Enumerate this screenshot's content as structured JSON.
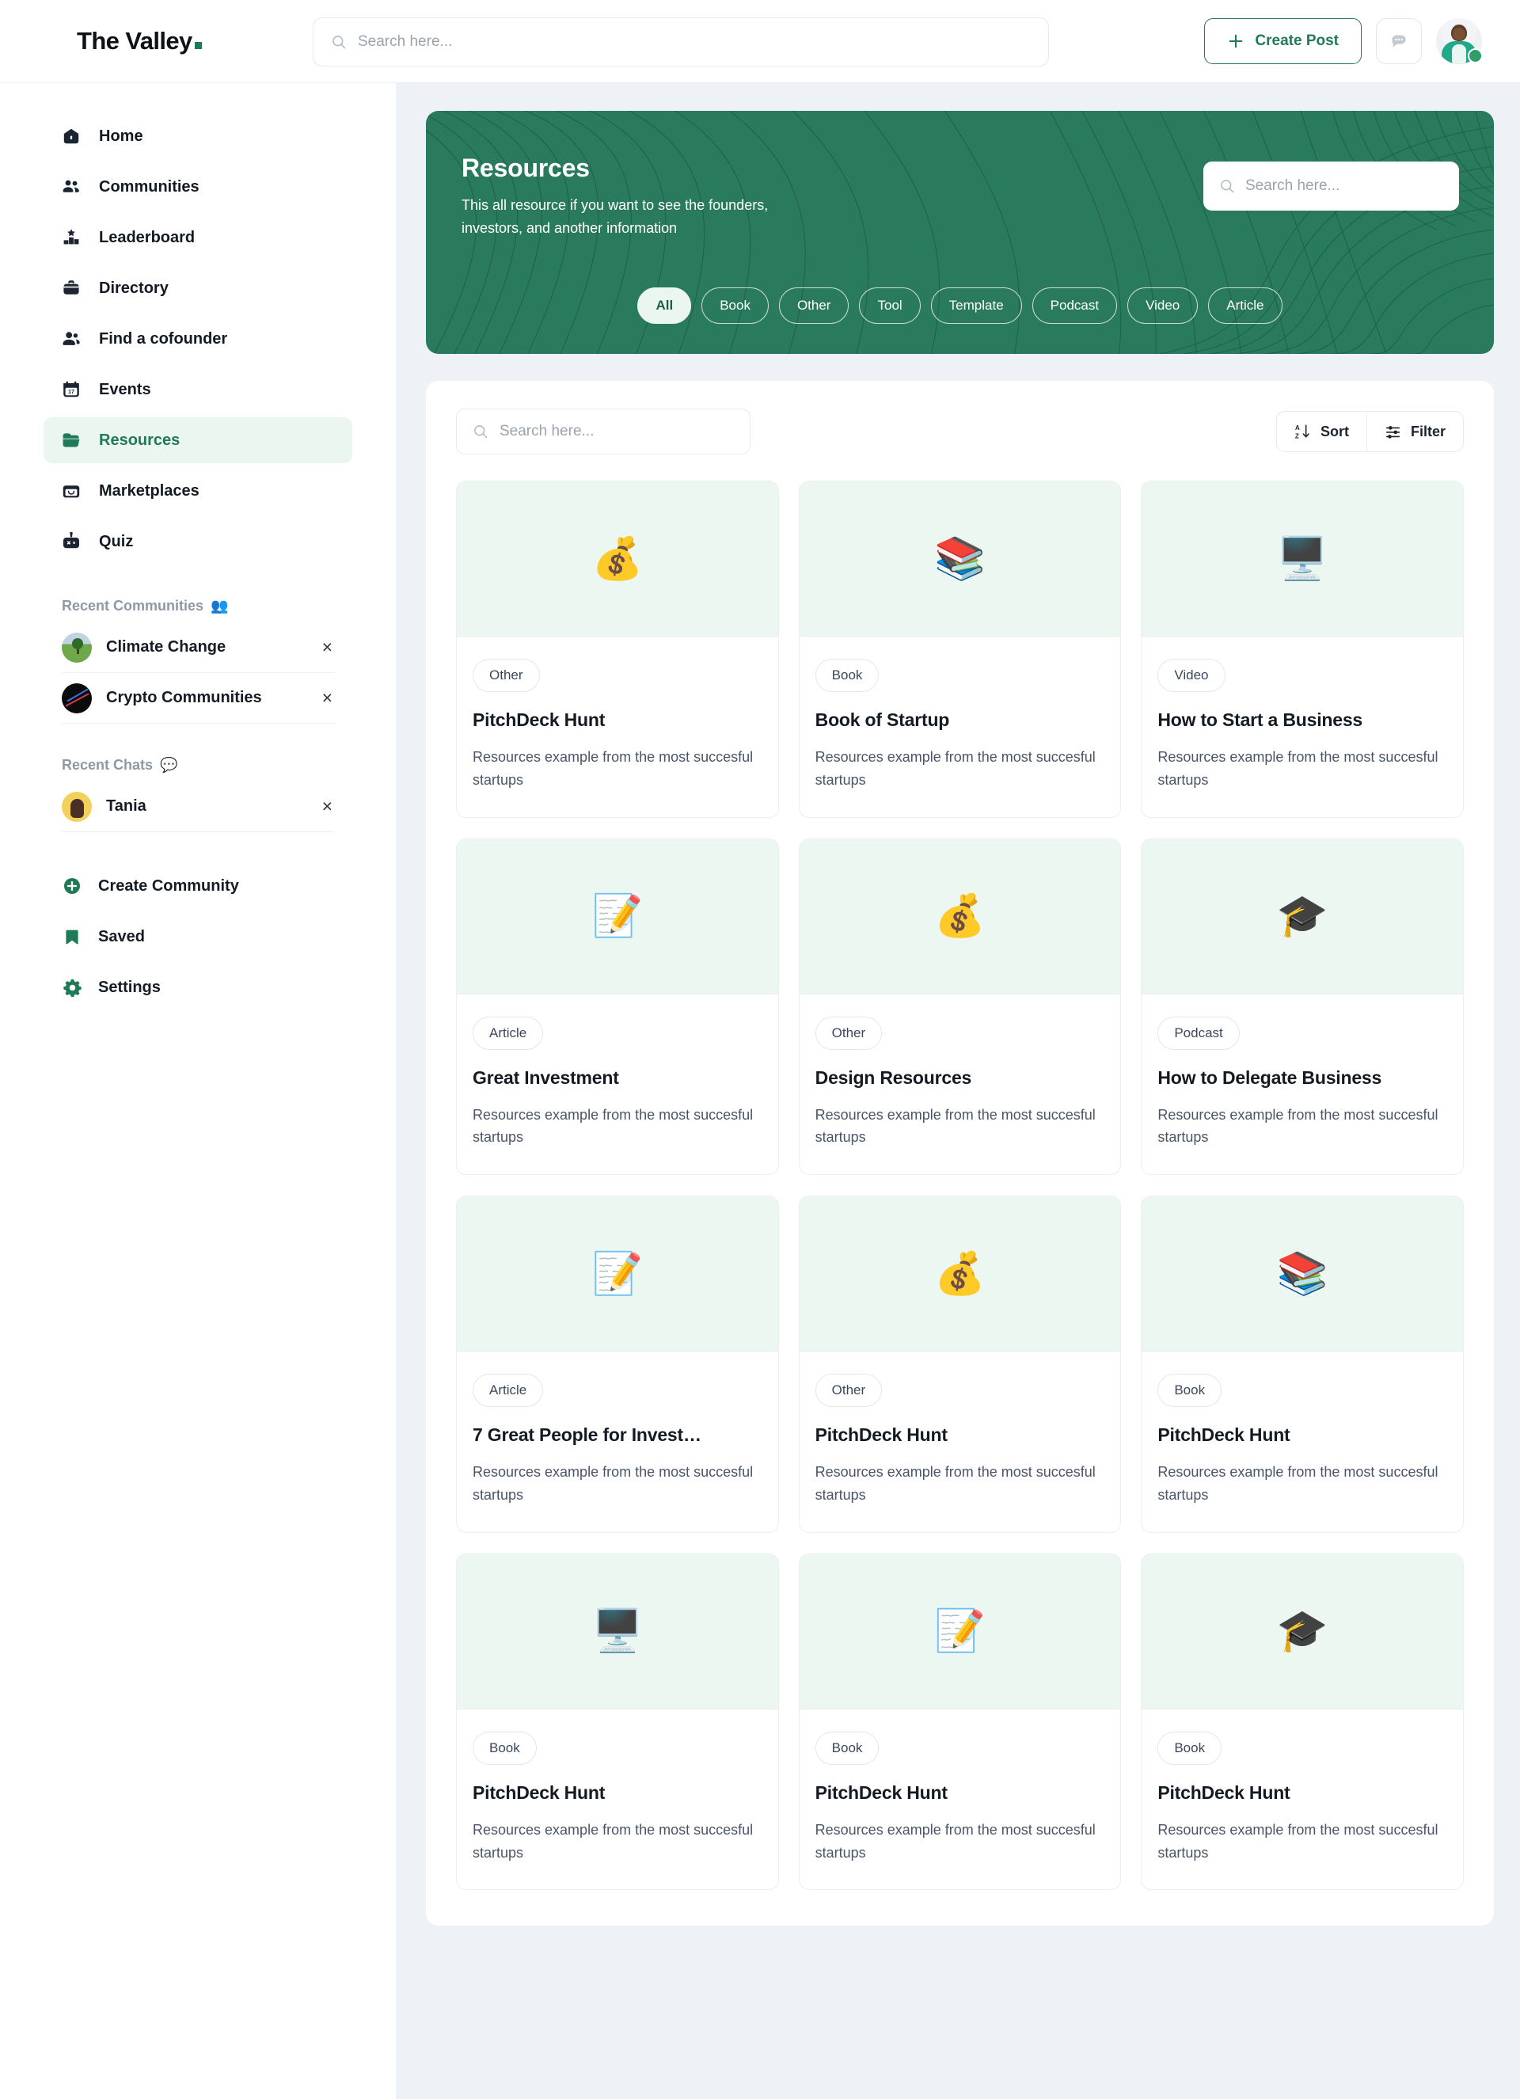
{
  "brand": {
    "name": "The Valley",
    "accent": "#1f7a58"
  },
  "topbar": {
    "search_placeholder": "Search here...",
    "create_post_label": "Create Post",
    "messages_icon": "chat-bubble-icon",
    "avatar_name": "user-avatar"
  },
  "sidebar": {
    "nav": [
      {
        "label": "Home",
        "icon": "home-icon",
        "active": false
      },
      {
        "label": "Communities",
        "icon": "people-group-icon",
        "active": false
      },
      {
        "label": "Leaderboard",
        "icon": "podium-star-icon",
        "active": false
      },
      {
        "label": "Directory",
        "icon": "briefcase-icon",
        "active": false
      },
      {
        "label": "Find a cofounder",
        "icon": "two-people-icon",
        "active": false
      },
      {
        "label": "Events",
        "icon": "calendar-icon",
        "active": false
      },
      {
        "label": "Resources",
        "icon": "folder-icon",
        "active": true
      },
      {
        "label": "Marketplaces",
        "icon": "store-icon",
        "active": false
      },
      {
        "label": "Quiz",
        "icon": "robot-icon",
        "active": false
      }
    ],
    "recent_communities_heading": "Recent Communities",
    "recent_communities_emoji": "👥",
    "recent_communities": [
      {
        "name": "Climate Change",
        "close": "×"
      },
      {
        "name": "Crypto Communities",
        "close": "×"
      }
    ],
    "recent_chats_heading": "Recent Chats",
    "recent_chats_emoji": "💬",
    "recent_chats": [
      {
        "name": "Tania",
        "close": "×"
      }
    ],
    "footer": [
      {
        "label": "Create Community",
        "icon": "plus-circle-icon"
      },
      {
        "label": "Saved",
        "icon": "bookmark-icon"
      },
      {
        "label": "Settings",
        "icon": "gear-icon"
      }
    ]
  },
  "hero": {
    "title": "Resources",
    "subtitle": "This all resource if you want to see the founders, investors, and another information",
    "search_placeholder": "Search here...",
    "banner_color": "#2a7a5e",
    "filters": [
      {
        "label": "All",
        "active": true
      },
      {
        "label": "Book",
        "active": false
      },
      {
        "label": "Other",
        "active": false
      },
      {
        "label": "Tool",
        "active": false
      },
      {
        "label": "Template",
        "active": false
      },
      {
        "label": "Podcast",
        "active": false
      },
      {
        "label": "Video",
        "active": false
      },
      {
        "label": "Article",
        "active": false
      }
    ]
  },
  "panel": {
    "search_placeholder": "Search here...",
    "sort_label": "Sort",
    "filter_label": "Filter",
    "cards": [
      {
        "emoji": "💰",
        "emoji_name": "money-bag-emoji",
        "tag": "Other",
        "title": "PitchDeck Hunt",
        "desc": "Resources example from the most succesful startups"
      },
      {
        "emoji": "📚",
        "emoji_name": "books-emoji",
        "tag": "Book",
        "title": "Book of Startup",
        "desc": "Resources example from the most succesful startups"
      },
      {
        "emoji": "🖥️",
        "emoji_name": "desktop-computer-emoji",
        "tag": "Video",
        "title": "How to Start a Business",
        "desc": "Resources example from the most succesful startups"
      },
      {
        "emoji": "📝",
        "emoji_name": "memo-emoji",
        "tag": "Article",
        "title": "Great Investment",
        "desc": "Resources example from the most succesful startups"
      },
      {
        "emoji": "💰",
        "emoji_name": "money-bag-emoji",
        "tag": "Other",
        "title": "Design Resources",
        "desc": "Resources example from the most succesful startups"
      },
      {
        "emoji": "🎓",
        "emoji_name": "graduation-cap-emoji",
        "tag": "Podcast",
        "title": "How to Delegate Business",
        "desc": "Resources example from the most succesful startups"
      },
      {
        "emoji": "📝",
        "emoji_name": "memo-emoji",
        "tag": "Article",
        "title": "7 Great People for Invest…",
        "desc": "Resources example from the most succesful startups"
      },
      {
        "emoji": "💰",
        "emoji_name": "money-bag-emoji",
        "tag": "Other",
        "title": "PitchDeck Hunt",
        "desc": "Resources example from the most succesful startups"
      },
      {
        "emoji": "📚",
        "emoji_name": "books-emoji",
        "tag": "Book",
        "title": "PitchDeck Hunt",
        "desc": "Resources example from the most succesful startups"
      },
      {
        "emoji": "🖥️",
        "emoji_name": "desktop-computer-emoji",
        "tag": "Book",
        "title": "PitchDeck Hunt",
        "desc": "Resources example from the most succesful startups"
      },
      {
        "emoji": "📝",
        "emoji_name": "memo-emoji",
        "tag": "Book",
        "title": "PitchDeck Hunt",
        "desc": "Resources example from the most succesful startups"
      },
      {
        "emoji": "🎓",
        "emoji_name": "graduation-cap-emoji",
        "tag": "Book",
        "title": "PitchDeck Hunt",
        "desc": "Resources example from the most succesful startups"
      }
    ]
  }
}
